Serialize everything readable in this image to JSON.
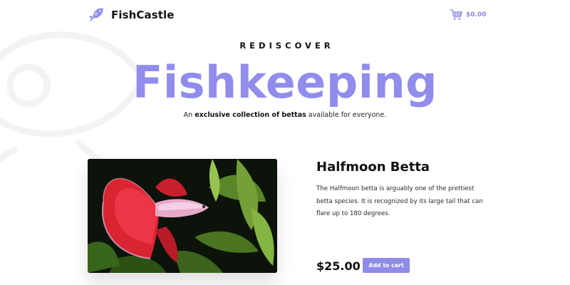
{
  "header": {
    "brand_name": "FishCastle",
    "cart_total": "$0.00"
  },
  "hero": {
    "eyebrow": "REDISCOVER",
    "title": "Fishkeeping",
    "tagline_prefix": "An ",
    "tagline_bold": "exclusive collection of bettas",
    "tagline_suffix": " available for everyone."
  },
  "product": {
    "name": "Halfmoon Betta",
    "description": "The Halfmoon betta is arguably one of the prettiest betta species. It is recognized by its large tail that can flare up to 180 degrees.",
    "price": "$25.00",
    "add_to_cart_label": "Add to cart"
  },
  "colors": {
    "accent": "#918dec",
    "button": "#8f8ce9"
  },
  "icons": {
    "brand_logo": "fish-icon",
    "cart": "shopping-cart-icon"
  }
}
